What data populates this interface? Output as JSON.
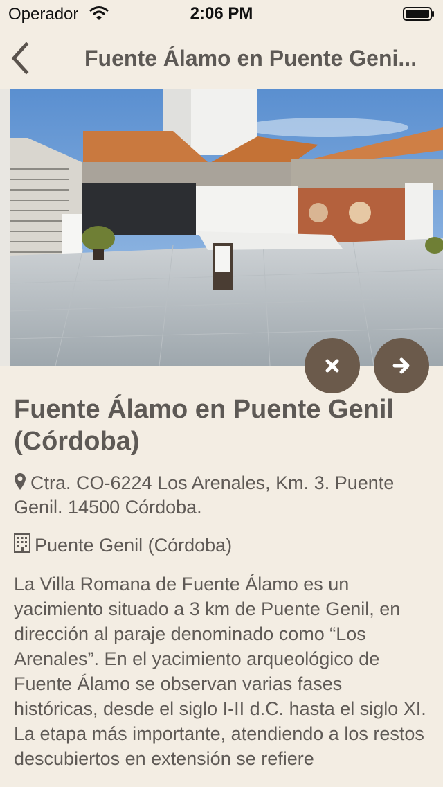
{
  "status_bar": {
    "carrier": "Operador",
    "time": "2:06 PM"
  },
  "nav": {
    "title": "Fuente Álamo en Puente Geni..."
  },
  "place": {
    "title": "Fuente Álamo en Puente Genil (Córdoba)",
    "address": "Ctra. CO-6224 Los Arenales, Km. 3. Puente Genil. 14500 Córdoba.",
    "town": "Puente Genil (Córdoba)",
    "description": "La Villa Romana de Fuente Álamo es un yacimiento situado a 3 km de Puente Genil, en dirección al paraje denominado como “Los Arenales”. En el yacimiento arqueológico de Fuente Álamo se observan varias fases históricas, desde el siglo I-II d.C. hasta el siglo XI. La etapa más importante, atendiendo a los restos descubiertos en extensión se refiere"
  },
  "icons": {
    "back": "chevron-left-icon",
    "close": "close-icon",
    "next": "arrow-right-icon",
    "pin": "map-pin-icon",
    "town": "building-icon"
  },
  "colors": {
    "background": "#f3ede3",
    "button": "#6b5a4b",
    "text": "#5d5955"
  }
}
